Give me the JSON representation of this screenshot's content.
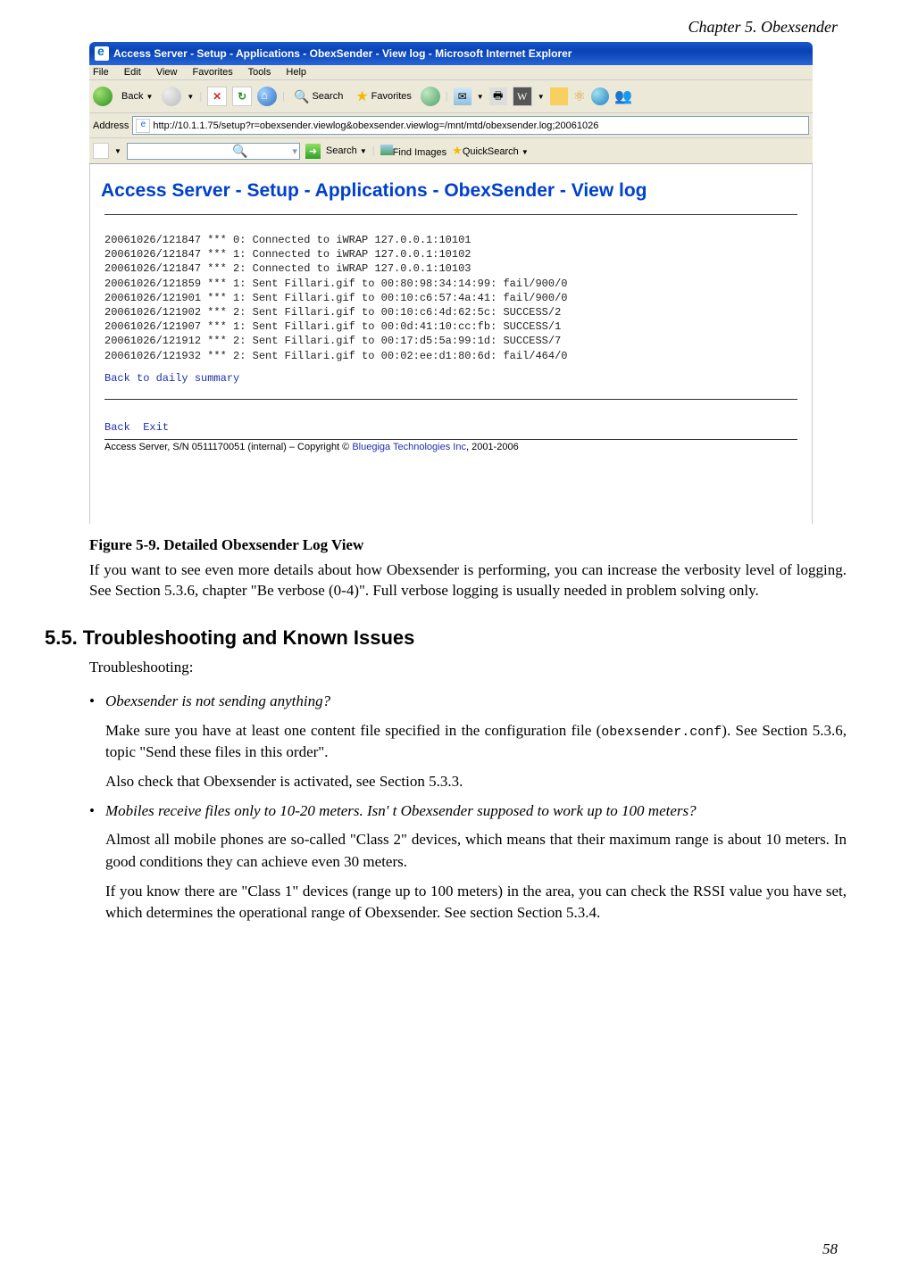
{
  "chapter": "Chapter 5. Obexsender",
  "browser": {
    "title": "Access Server - Setup - Applications - ObexSender - View log - Microsoft Internet Explorer",
    "menus": [
      "File",
      "Edit",
      "View",
      "Favorites",
      "Tools",
      "Help"
    ],
    "back_label": "Back",
    "search_label": "Search",
    "favorites_label": "Favorites",
    "address_label": "Address",
    "url": "http://10.1.1.75/setup?r=obexsender.viewlog&obexsender.viewlog=/mnt/mtd/obexsender.log;20061026",
    "search_btn": "Search",
    "find_images": "Find Images",
    "quicksearch": "QuickSearch"
  },
  "logpage": {
    "heading": "Access Server - Setup - Applications - ObexSender - View log",
    "lines": [
      "20061026/121847 *** 0: Connected to iWRAP 127.0.0.1:10101",
      "20061026/121847 *** 1: Connected to iWRAP 127.0.0.1:10102",
      "20061026/121847 *** 2: Connected to iWRAP 127.0.0.1:10103",
      "20061026/121859 *** 1: Sent Fillari.gif to 00:80:98:34:14:99: fail/900/0",
      "20061026/121901 *** 1: Sent Fillari.gif to 00:10:c6:57:4a:41: fail/900/0",
      "20061026/121902 *** 2: Sent Fillari.gif to 00:10:c6:4d:62:5c: SUCCESS/2",
      "20061026/121907 *** 1: Sent Fillari.gif to 00:0d:41:10:cc:fb: SUCCESS/1",
      "20061026/121912 *** 2: Sent Fillari.gif to 00:17:d5:5a:99:1d: SUCCESS/7",
      "20061026/121932 *** 2: Sent Fillari.gif to 00:02:ee:d1:80:6d: fail/464/0"
    ],
    "back_summary": "Back to daily summary",
    "back": "Back",
    "exit": "Exit",
    "copy_prefix": "Access Server, S/N 0511170051 (internal)  –  Copyright © ",
    "copy_link": "Bluegiga Technologies Inc",
    "copy_suffix": ", 2001-2006"
  },
  "figure_caption": "Figure 5-9. Detailed Obexsender Log View",
  "para_after_fig": "If you want to see even more details about how Obexsender is performing, you can increase the verbosity level of logging. See Section 5.3.6, chapter \"Be verbose (0-4)\". Full verbose logging is usually needed in problem solving only.",
  "section_heading": "5.5. Troubleshooting and Known Issues",
  "troubleshooting_label": "Troubleshooting:",
  "items": [
    {
      "q": "Obexsender is not sending anything?",
      "p1a": "Make sure you have at least one content file specified in the configuration file (",
      "code": "obexsender.conf",
      "p1b": "). See Section 5.3.6, topic \"Send these files in this order\".",
      "p2": "Also check that Obexsender is activated, see Section 5.3.3."
    },
    {
      "q": "Mobiles receive files only to 10-20 meters. Isn' t Obexsender supposed to work up to 100 meters?",
      "p1": "Almost all mobile phones are so-called \"Class 2\" devices, which means that their maximum range is about 10 meters. In good conditions they can achieve even 30 meters.",
      "p2": "If you know there are \"Class 1\" devices (range up to 100 meters) in the area, you can check the RSSI value you have set, which determines the operational range of Obexsender. See section Section 5.3.4."
    }
  ],
  "page_number": "58"
}
